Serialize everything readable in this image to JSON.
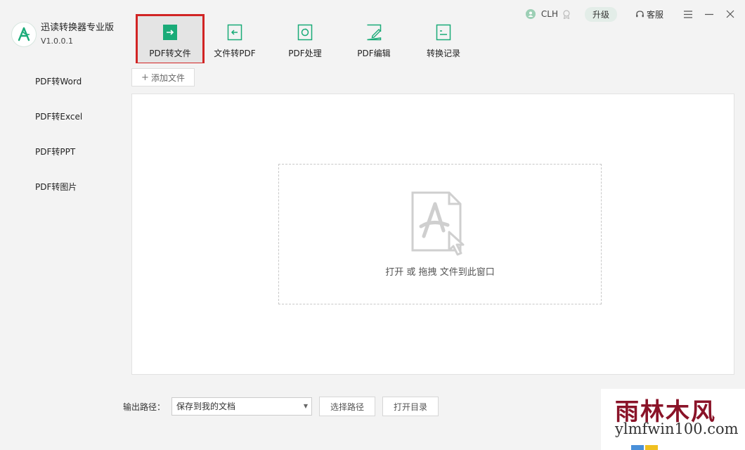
{
  "app": {
    "name": "迅读转换器专业版",
    "version": "V1.0.0.1"
  },
  "toolbar": [
    {
      "label": "PDF转文件",
      "icon": "file-export-icon",
      "active": true
    },
    {
      "label": "文件转PDF",
      "icon": "file-import-icon",
      "active": false
    },
    {
      "label": "PDF处理",
      "icon": "file-process-icon",
      "active": false
    },
    {
      "label": "PDF编辑",
      "icon": "file-edit-icon",
      "active": false
    },
    {
      "label": "转换记录",
      "icon": "history-icon",
      "active": false
    }
  ],
  "user": {
    "name": "CLH",
    "upgrade_label": "升级",
    "service_label": "客服"
  },
  "sidebar": {
    "items": [
      {
        "label": "PDF转Word"
      },
      {
        "label": "PDF转Excel"
      },
      {
        "label": "PDF转PPT"
      },
      {
        "label": "PDF转图片"
      }
    ]
  },
  "main": {
    "add_file_label": "添加文件",
    "drop_text": "打开 或 拖拽 文件到此窗口"
  },
  "output": {
    "label": "输出路径：",
    "path_value": "保存到我的文档",
    "choose_path_label": "选择路径",
    "open_dir_label": "打开目录"
  },
  "watermark": {
    "cn": "雨林木风",
    "en": "ylmfwin100.com"
  },
  "colors": {
    "accent": "#1aab78",
    "highlight": "#d12424"
  }
}
